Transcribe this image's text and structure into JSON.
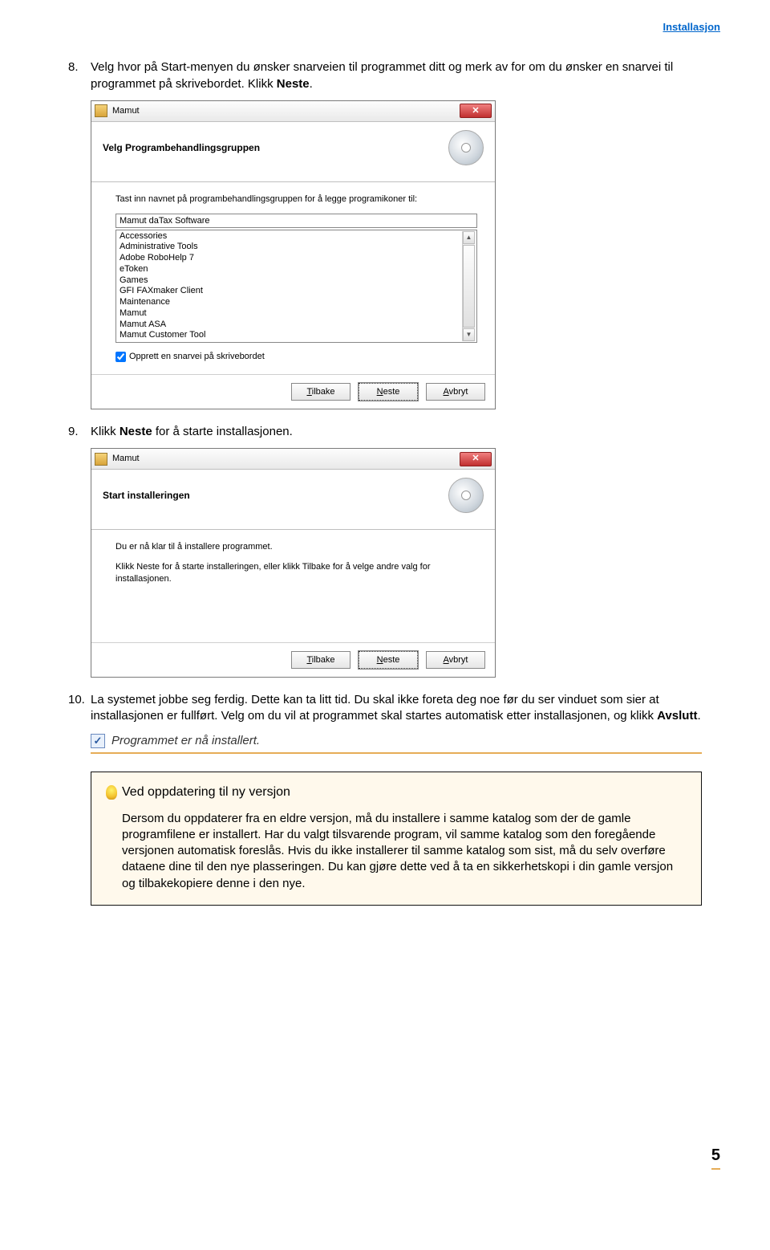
{
  "header": {
    "link_text": "Installasjon"
  },
  "steps": {
    "s8": {
      "num": "8.",
      "text_a": "Velg hvor på Start-menyen du ønsker snarveien til programmet ditt og merk av for om du ønsker en snarvei til programmet på skrivebordet. Klikk ",
      "text_b": "Neste",
      "text_c": "."
    },
    "s9": {
      "num": "9.",
      "text_a": "Klikk ",
      "text_b": "Neste",
      "text_c": " for å starte installasjonen."
    },
    "s10": {
      "num": "10.",
      "text_a": "La systemet jobbe seg ferdig. Dette kan ta litt tid. Du skal ikke foreta deg noe før du ser vinduet som sier at installasjonen er fullført. Velg om du vil at programmet skal startes automatisk etter installasjonen, og klikk ",
      "text_b": "Avslutt",
      "text_c": "."
    }
  },
  "dialog1": {
    "title": "Mamut",
    "heading": "Velg Programbehandlingsgruppen",
    "instruction": "Tast inn navnet på programbehandlingsgruppen for å legge programikoner til:",
    "input_value": "Mamut daTax Software",
    "list": [
      "Accessories",
      "Administrative Tools",
      "Adobe RoboHelp 7",
      "eToken",
      "Games",
      "GFI FAXmaker Client",
      "Maintenance",
      "Mamut",
      "Mamut ASA",
      "Mamut Customer Tool"
    ],
    "checkbox_label": "Opprett en snarvei på skrivebordet",
    "buttons": {
      "back_u": "T",
      "back_rest": "ilbake",
      "next_u": "N",
      "next_rest": "este",
      "cancel_u": "A",
      "cancel_rest": "vbryt"
    }
  },
  "dialog2": {
    "title": "Mamut",
    "heading": "Start installeringen",
    "line1": "Du er nå klar til å installere programmet.",
    "line2": "Klikk Neste for å starte installeringen, eller klikk Tilbake for å velge andre valg for installasjonen.",
    "buttons": {
      "back_u": "T",
      "back_rest": "ilbake",
      "next_u": "N",
      "next_rest": "este",
      "cancel_u": "A",
      "cancel_rest": "vbryt"
    }
  },
  "complete": {
    "text": "Programmet er nå installert."
  },
  "note": {
    "title": "Ved oppdatering til ny versjon",
    "body": "Dersom du oppdaterer fra en eldre versjon, må du installere i samme katalog som der de gamle programfilene er installert. Har du valgt tilsvarende program, vil samme katalog som den foregående versjonen automatisk foreslås. Hvis du ikke installerer til samme katalog som sist, må du selv overføre dataene dine til den nye plasseringen. Du kan gjøre dette ved å ta en sikkerhetskopi i din gamle versjon og tilbakekopiere denne i den nye."
  },
  "page_number": "5"
}
